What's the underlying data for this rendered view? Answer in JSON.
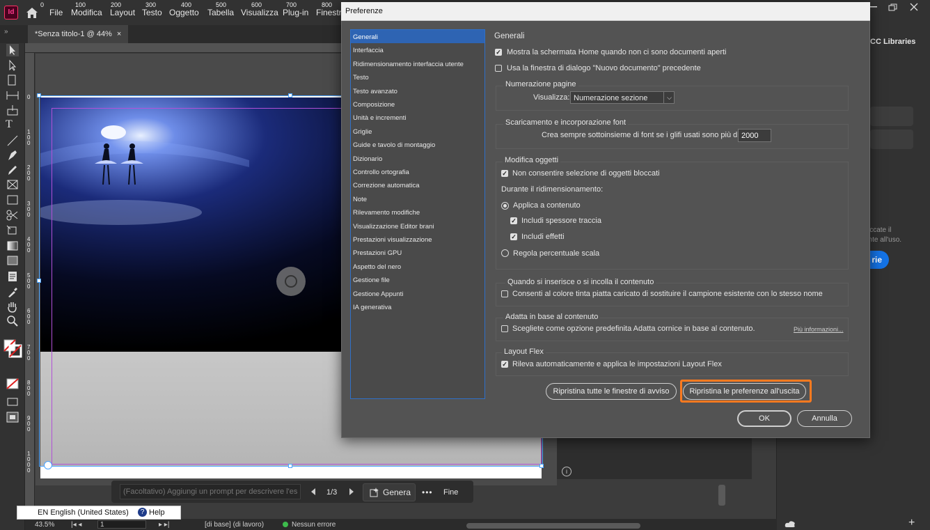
{
  "app": {
    "logo": "Id",
    "menu": [
      "File",
      "Modifica",
      "Layout",
      "Testo",
      "Oggetto",
      "Tabella",
      "Visualizza",
      "Plug-in",
      "Finestra"
    ]
  },
  "document_tab": {
    "label": "*Senza titolo-1 @ 44%",
    "close": "×"
  },
  "ruler": {
    "h_ticks": [
      "0",
      "100",
      "200",
      "300",
      "400",
      "500",
      "600",
      "700",
      "800"
    ],
    "v_ticks": [
      "0",
      "1\n0\n0",
      "2\n0\n0",
      "3\n0\n0",
      "4\n0\n0",
      "5\n0\n0",
      "6\n0\n0",
      "7\n0\n0",
      "8\n0\n0",
      "9\n0\n0",
      "1\n0\n0\n0"
    ]
  },
  "right_panel": {
    "tab": "CC Libraries",
    "hint_text": "ciccate il\nente all'uso.",
    "button_label": "rie"
  },
  "prompt_bar": {
    "placeholder": "(Facoltativo) Aggiungi un prompt per descrivere l'espans",
    "page": "1/3",
    "generate": "Genera",
    "more": "•••",
    "done": "Fine"
  },
  "language_bar": {
    "language": "EN English (United States)",
    "help": "Help"
  },
  "status_bar": {
    "zoom": "43.5%",
    "page": "1",
    "style": "[di base] (di lavoro)",
    "errors": "Nessun errore"
  },
  "dialog": {
    "title": "Preferenze",
    "categories": [
      "Generali",
      "Interfaccia",
      "Ridimensionamento interfaccia utente",
      "Testo",
      "Testo avanzato",
      "Composizione",
      "Unità e incrementi",
      "Griglie",
      "Guide e tavolo di montaggio",
      "Dizionario",
      "Controllo ortografia",
      "Correzione automatica",
      "Note",
      "Rilevamento modifiche",
      "Visualizzazione Editor brani",
      "Prestazioni visualizzazione",
      "Prestazioni GPU",
      "Aspetto del nero",
      "Gestione file",
      "Gestione Appunti",
      "IA generativa"
    ],
    "selected_category": "Generali",
    "section_title": "Generali",
    "show_home": {
      "label": "Mostra la schermata Home quando non ci sono documenti aperti",
      "checked": true
    },
    "legacy_new_doc": {
      "label": "Usa la finestra di dialogo \"Nuovo documento\" precedente",
      "checked": false
    },
    "page_numbering": {
      "title": "Numerazione pagine",
      "label": "Visualizza:",
      "value": "Numerazione sezione"
    },
    "font_download": {
      "title": "Scaricamento e incorporazione font",
      "label": "Crea sempre sottoinsieme di font se i glifi usati sono più di:",
      "value": "2000"
    },
    "object_editing": {
      "title": "Modifica oggetti",
      "prevent_locked": {
        "label": "Non consentire selezione di oggetti bloccati",
        "checked": true
      },
      "while_scaling": "Durante il ridimensionamento:",
      "apply_to_content": {
        "label": "Applica a contenuto",
        "selected": true
      },
      "include_stroke": {
        "label": "Includi spessore traccia",
        "checked": true
      },
      "include_effects": {
        "label": "Includi effetti",
        "checked": true
      },
      "adjust_scale": {
        "label": "Regola percentuale scala",
        "selected": false
      }
    },
    "paste": {
      "title": "Quando si inserisce o si incolla il contenuto",
      "allow_swatch": {
        "label": "Consenti al colore tinta piatta caricato di sostituire il campione esistente con lo stesso nome",
        "checked": false
      }
    },
    "content_aware": {
      "title": "Adatta in base al contenuto",
      "default_fit": {
        "label": "Scegliete come opzione predefinita Adatta cornice in base al contenuto.",
        "checked": false
      },
      "more_info": "Più informazioni..."
    },
    "flex_layout": {
      "title": "Layout Flex",
      "auto_detect": {
        "label": "Rileva automaticamente e applica le impostazioni Layout Flex",
        "checked": true
      }
    },
    "buttons": {
      "reset_warnings": "Ripristina tutte le finestre di avviso",
      "reset_prefs": "Ripristina le preferenze all'uscita",
      "ok": "OK",
      "cancel": "Annulla"
    },
    "highlight_color": "#ff7a1f"
  }
}
